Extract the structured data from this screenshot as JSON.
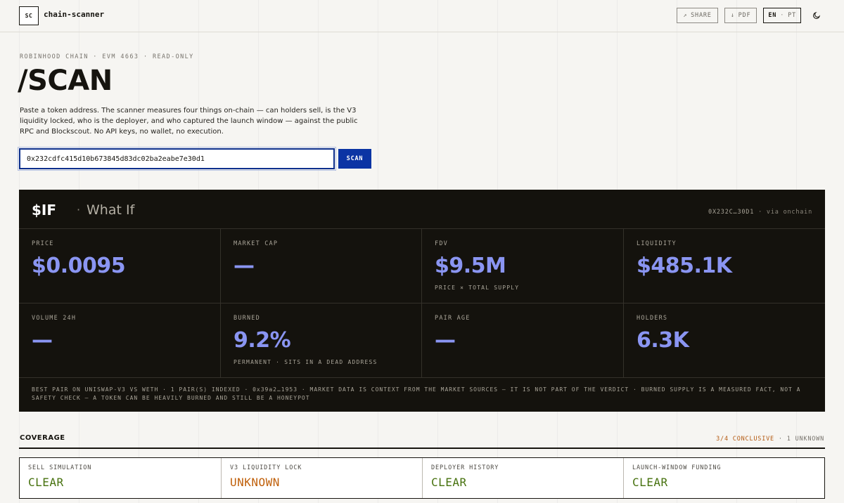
{
  "header": {
    "logo": "SC",
    "brand": "chain-scanner",
    "share_label": "SHARE",
    "pdf_label": "PDF",
    "lang_active": "EN",
    "lang_sep": "·",
    "lang_other": "PT"
  },
  "hero": {
    "eyebrow": "ROBINHOOD CHAIN · EVM 4663 · READ-ONLY",
    "title": "/SCAN",
    "lede": "Paste a token address. The scanner measures four things on-chain — can holders sell, is the V3 liquidity locked, who is the deployer, and who captured the launch window — against the public RPC and Blockscout. No API keys, no wallet, no execution.",
    "input_value": "0x232cdfc415d10b673845d83dc02ba2eabe7e30d1",
    "scan_label": "SCAN"
  },
  "token": {
    "ticker": "$IF",
    "separator": "·",
    "name": "What If",
    "address_short": "0X232C…30D1",
    "source_sep": "·",
    "source": "via onchain",
    "metrics": [
      {
        "label": "PRICE",
        "value": "$0.0095",
        "sub": ""
      },
      {
        "label": "MARKET CAP",
        "value": "—",
        "sub": ""
      },
      {
        "label": "FDV",
        "value": "$9.5M",
        "sub": "PRICE × TOTAL SUPPLY"
      },
      {
        "label": "LIQUIDITY",
        "value": "$485.1K",
        "sub": ""
      },
      {
        "label": "VOLUME 24H",
        "value": "—",
        "sub": ""
      },
      {
        "label": "BURNED",
        "value": "9.2%",
        "sub": "PERMANENT · SITS IN A DEAD ADDRESS"
      },
      {
        "label": "PAIR AGE",
        "value": "—",
        "sub": ""
      },
      {
        "label": "HOLDERS",
        "value": "6.3K",
        "sub": ""
      }
    ],
    "note": "BEST PAIR ON UNISWAP-V3 VS WETH · 1 PAIR(S) INDEXED · 0x39a2…1953 · MARKET DATA IS CONTEXT FROM THE MARKET SOURCES — IT IS NOT PART OF THE VERDICT · BURNED SUPPLY IS A MEASURED FACT, NOT A SAFETY CHECK — A TOKEN CAN BE HEAVILY BURNED AND STILL BE A HONEYPOT"
  },
  "coverage": {
    "title": "COVERAGE",
    "conclusive": "3/4 CONCLUSIVE",
    "sep": "·",
    "unknown": "1 UNKNOWN",
    "items": [
      {
        "label": "SELL SIMULATION",
        "status": "CLEAR"
      },
      {
        "label": "V3 LIQUIDITY LOCK",
        "status": "UNKNOWN"
      },
      {
        "label": "DEPLOYER HISTORY",
        "status": "CLEAR"
      },
      {
        "label": "LAUNCH-WINDOW FUNDING",
        "status": "CLEAR"
      }
    ]
  },
  "icons": {
    "share": "share-arrow-icon",
    "pdf": "download-icon",
    "theme": "moon-icon"
  },
  "colors": {
    "accent": "#0b34a4",
    "metric": "#8a95f2",
    "clear": "#47720f",
    "unknown": "#c0600b"
  }
}
